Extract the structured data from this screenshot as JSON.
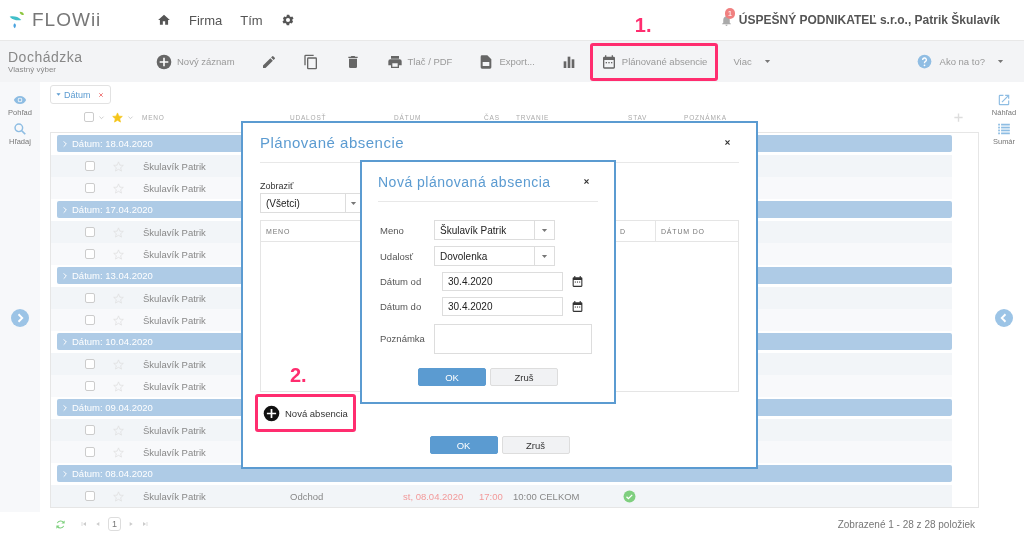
{
  "app": {
    "logo": "FLOWii",
    "nav": [
      {
        "kind": "home"
      },
      {
        "kind": "link",
        "label": "Firma"
      },
      {
        "kind": "link",
        "label": "Tím"
      },
      {
        "kind": "settings"
      }
    ],
    "notifications": {
      "count": "1"
    },
    "account": "ÚSPEŠNÝ PODNIKATEĽ s.r.o., Patrik Škulavík"
  },
  "toolbar": {
    "title": "Dochádzka",
    "subtitle": "Vlastný výber",
    "actions": [
      {
        "kind": "plus-circle",
        "label": "Nový záznam",
        "highlighted": false
      },
      {
        "kind": "pencil",
        "highlighted": false
      },
      {
        "kind": "copy",
        "highlighted": false
      },
      {
        "kind": "trash",
        "highlighted": false
      },
      {
        "kind": "printer",
        "label": "Tlač / PDF",
        "highlighted": false
      },
      {
        "kind": "document",
        "label": "Export...",
        "highlighted": false
      },
      {
        "kind": "chart",
        "highlighted": false
      },
      {
        "kind": "calendar",
        "label": "Plánované absencie",
        "highlighted": true,
        "annotation": "1."
      },
      {
        "kind": "menu",
        "label": "Viac",
        "highlighted": false
      }
    ],
    "help": {
      "label": "Ako na to?"
    }
  },
  "left_sidebar": [
    {
      "kind": "eye",
      "label": "Pohľad"
    },
    {
      "kind": "search",
      "label": "Hľadaj"
    }
  ],
  "right_sidebar": [
    {
      "kind": "external",
      "label": "Náhľad"
    },
    {
      "kind": "list",
      "label": "Sumár"
    }
  ],
  "filters": [
    {
      "label": "Dátum"
    }
  ],
  "table": {
    "all_checked": false,
    "columns": [
      "MENO",
      "UDALOSŤ",
      "DÁTUM",
      "ČAS",
      "TRVANIE",
      "STAV",
      "POZNÁMKA"
    ],
    "groups": [
      {
        "label": "Dátum: 18.04.2020",
        "rows": [
          {
            "name": "Škulavík Patrik",
            "checked": false,
            "starred": false
          },
          {
            "name": "Škulavík Patrik",
            "checked": false,
            "starred": false
          }
        ]
      },
      {
        "label": "Dátum: 17.04.2020",
        "rows": [
          {
            "name": "Škulavík Patrik",
            "checked": false,
            "starred": false
          },
          {
            "name": "Škulavík Patrik",
            "checked": false,
            "starred": false
          }
        ]
      },
      {
        "label": "Dátum: 13.04.2020",
        "rows": [
          {
            "name": "Škulavík Patrik",
            "checked": false,
            "starred": false
          },
          {
            "name": "Škulavík Patrik",
            "checked": false,
            "starred": false
          }
        ]
      },
      {
        "label": "Dátum: 10.04.2020",
        "rows": [
          {
            "name": "Škulavík Patrik",
            "checked": false,
            "starred": false
          },
          {
            "name": "Škulavík Patrik",
            "checked": false,
            "starred": false
          }
        ]
      },
      {
        "label": "Dátum: 09.04.2020",
        "rows": [
          {
            "name": "Škulavík Patrik",
            "checked": false,
            "starred": false
          },
          {
            "name": "Škulavík Patrik",
            "checked": false,
            "starred": false
          }
        ]
      },
      {
        "label": "Dátum: 08.04.2020",
        "rows": [
          {
            "name": "Škulavík Patrik",
            "checked": false,
            "starred": false,
            "event": "Odchod",
            "date": "st, 08.04.2020",
            "time": "17:00",
            "duration": "10:00 CELKOM",
            "approved": true
          }
        ]
      }
    ]
  },
  "pager": {
    "page": "1",
    "summary": "Zobrazené 1 - 28 z 28 položiek"
  },
  "dialog": {
    "title": "Plánované absencie",
    "filter_label": "Zobraziť",
    "filter_value": "(Všetci)",
    "columns": [
      "MENO",
      "D",
      "DÁTUM DO"
    ],
    "add_button": {
      "label": "Nová absencia",
      "highlighted": true,
      "annotation": "2."
    },
    "buttons": [
      {
        "label": "OK",
        "primary": true
      },
      {
        "label": "Zruš",
        "primary": false
      }
    ]
  },
  "subdialog": {
    "title": "Nová plánovaná absencia",
    "fields": [
      {
        "kind": "select",
        "label": "Meno",
        "value": "Škulavík Patrik"
      },
      {
        "kind": "select",
        "label": "Udalosť",
        "value": "Dovolenka"
      },
      {
        "kind": "date",
        "label": "Dátum od",
        "value": "30.4.2020"
      },
      {
        "kind": "date",
        "label": "Dátum do",
        "value": "30.4.2020"
      },
      {
        "kind": "textarea",
        "label": "Poznámka"
      }
    ],
    "buttons": [
      {
        "label": "OK",
        "primary": true
      },
      {
        "label": "Zruš",
        "primary": false
      }
    ]
  }
}
